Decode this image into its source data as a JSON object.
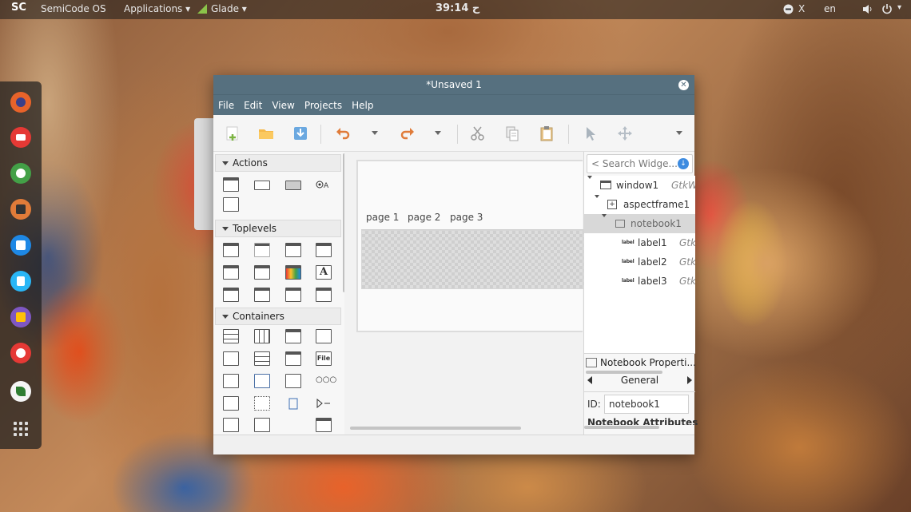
{
  "topbar": {
    "logo": "SC",
    "os_name": "SemiCode OS",
    "applications": "Applications ▾",
    "active_app": "Glade ▾",
    "clock": "39:14 ح",
    "close_label": "X",
    "lang": "en"
  },
  "dock": {
    "apps": [
      "firefox-icon",
      "mail-icon",
      "chat-icon",
      "music-player-icon",
      "notes-icon",
      "document-icon",
      "files-icon",
      "help-lifebuoy-icon",
      "semicode-icon",
      "app-grid-icon"
    ]
  },
  "window": {
    "title": "*Unsaved 1",
    "menu": [
      "File",
      "Edit",
      "View",
      "Projects",
      "Help"
    ],
    "palette": {
      "groups": [
        "Actions",
        "Toplevels",
        "Containers"
      ]
    },
    "notebook_tabs": [
      "page 1",
      "page 2",
      "page 3"
    ],
    "search_placeholder": "Search Widge...",
    "tree": [
      {
        "name": "window1",
        "cls": "GtkW"
      },
      {
        "name": "aspectframe1",
        "cls": ""
      },
      {
        "name": "notebook1",
        "cls": ""
      },
      {
        "name": "label1",
        "cls": "Gtk"
      },
      {
        "name": "label2",
        "cls": "Gtk"
      },
      {
        "name": "label3",
        "cls": "Gtk"
      }
    ],
    "label_icon_text": "label",
    "properties": {
      "header": "Notebook Properti...",
      "tab": "General",
      "id_label": "ID:",
      "id_value": "notebook1",
      "section": "Notebook Attributes"
    }
  },
  "colors": {
    "titlebar": "#56707f",
    "accent_blue": "#3d8be0"
  }
}
